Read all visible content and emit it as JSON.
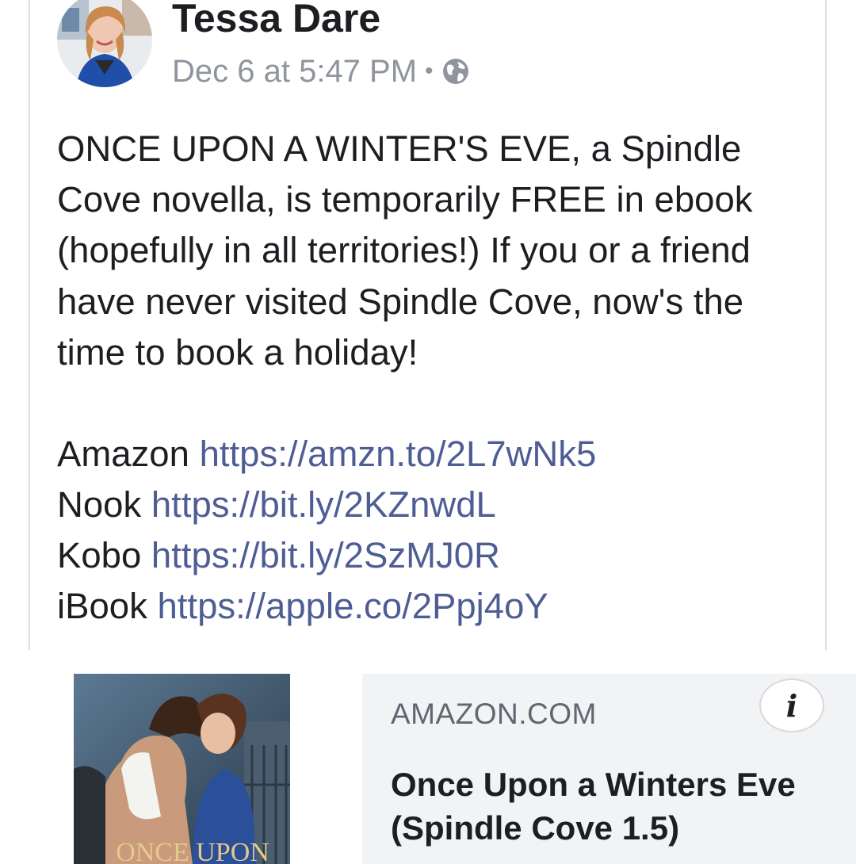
{
  "post": {
    "author": "Tessa Dare",
    "timestamp": "Dec 6 at 5:47 PM",
    "separator": "•",
    "privacy_icon": "globe-icon",
    "body": "ONCE UPON A WINTER'S EVE, a Spindle Cove novella, is temporarily FREE in ebook (hopefully in all territories!) If you or a friend have never visited Spindle Cove, now's the time to book a holiday!",
    "links": [
      {
        "store": "Amazon",
        "url": "https://amzn.to/2L7wNk5"
      },
      {
        "store": "Nook",
        "url": "https://bit.ly/2KZnwdL"
      },
      {
        "store": "Kobo",
        "url": "https://bit.ly/2SzMJ0R"
      },
      {
        "store": "iBook",
        "url": "https://apple.co/2Ppj4oY"
      }
    ]
  },
  "link_preview": {
    "domain": "AMAZON.COM",
    "title": "Once Upon a Winters Eve (Spindle Cove 1.5)",
    "cover_text": "ONCE UPON",
    "info_icon": "info-icon",
    "info_glyph": "i"
  },
  "colors": {
    "link": "#4e5d94",
    "meta": "#90949c",
    "preview_bg": "#f2f3f5",
    "text": "#1c1e21"
  }
}
